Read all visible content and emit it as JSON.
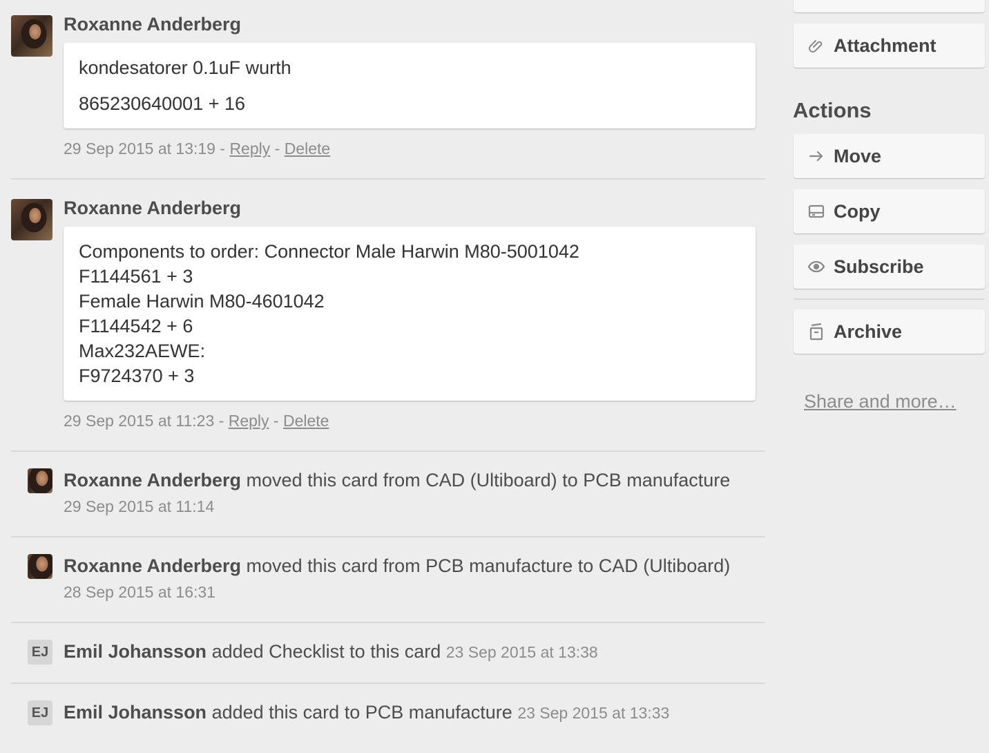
{
  "comments": [
    {
      "author": "Roxanne Anderberg",
      "lines": [
        "kondesatorer 0.1uF wurth",
        "865230640001 + 16"
      ],
      "timestamp": "29 Sep 2015 at 13:19",
      "dash1": " - ",
      "reply_label": "Reply",
      "dash2": " - ",
      "delete_label": "Delete"
    },
    {
      "author": "Roxanne Anderberg",
      "lines": [
        "Components to order: Connector Male Harwin M80-5001042",
        "F1144561 + 3",
        "Female Harwin M80-4601042",
        "F1144542 + 6",
        "Max232AEWE:",
        "F9724370 + 3"
      ],
      "timestamp": "29 Sep 2015 at 11:23",
      "dash1": " - ",
      "reply_label": "Reply",
      "dash2": " - ",
      "delete_label": "Delete"
    }
  ],
  "activities": [
    {
      "author": "Roxanne Anderberg",
      "text": " moved this card from CAD (Ultiboard) to PCB manufacture",
      "timestamp": "29 Sep 2015 at 11:14"
    },
    {
      "author": "Roxanne Anderberg",
      "text": " moved this card from PCB manufacture to CAD (Ultiboard)",
      "timestamp": "28 Sep 2015 at 16:31"
    },
    {
      "initials": "EJ",
      "author": "Emil Johansson",
      "text": " added Checklist to this card ",
      "timestamp": "23 Sep 2015 at 13:38"
    },
    {
      "initials": "EJ",
      "author": "Emil Johansson",
      "text": " added this card to PCB manufacture ",
      "timestamp": "23 Sep 2015 at 13:33"
    }
  ],
  "sidebar": {
    "attachment_label": "Attachment",
    "actions_heading": "Actions",
    "move_label": "Move",
    "copy_label": "Copy",
    "subscribe_label": "Subscribe",
    "archive_label": "Archive",
    "share_label": "Share and more…"
  },
  "icons": {
    "attachment": "paperclip-icon",
    "move": "arrow-right-icon",
    "copy": "card-copy-icon",
    "subscribe": "eye-icon",
    "archive": "archive-box-icon"
  }
}
